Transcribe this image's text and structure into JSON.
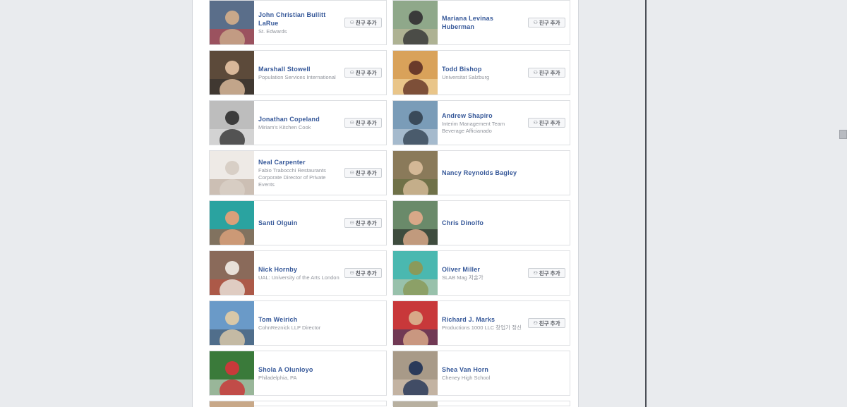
{
  "add_friend_label": "친구 추가",
  "add_friend_icon": "person-plus-icon",
  "people": [
    {
      "name": "John Christian Bullitt LaRue",
      "sub": "St. Edwards",
      "button": true,
      "photo": {
        "bg": "#5a6e8a",
        "fg": "#c9a88a",
        "accent": "#d23c3c"
      }
    },
    {
      "name": "Mariana Levinas Huberman",
      "sub": "",
      "button": true,
      "photo": {
        "bg": "#8fa88a",
        "fg": "#3a3a3a",
        "accent": "#c8b99a"
      }
    },
    {
      "name": "Marshall Stowell",
      "sub": "Population Services International",
      "button": true,
      "photo": {
        "bg": "#5c4a3a",
        "fg": "#d9b89a",
        "accent": "#2a2a2a"
      }
    },
    {
      "name": "Todd Bishop",
      "sub": "Universitat Salzburg",
      "button": true,
      "photo": {
        "bg": "#d9a25a",
        "fg": "#6a3a2a",
        "accent": "#f5e2b0"
      }
    },
    {
      "name": "Jonathan Copeland",
      "sub": "Miriam's Kitchen Cook",
      "button": true,
      "photo": {
        "bg": "#bdbdbd",
        "fg": "#3c3c3c",
        "accent": "#e6e6e6"
      }
    },
    {
      "name": "Andrew Shapiro",
      "sub": "Interim Management Team Beverage Afficianado",
      "button": true,
      "photo": {
        "bg": "#7a9cb8",
        "fg": "#3a4a5a",
        "accent": "#c8d4de"
      }
    },
    {
      "name": "Neal Carpenter",
      "sub": "Fabio Trabocchi Restaurants Corporate Director of Private Events",
      "button": true,
      "photo": {
        "bg": "#eeeae6",
        "fg": "#d8cfc6",
        "accent": "#b09a8a"
      }
    },
    {
      "name": "Nancy Reynolds Bagley",
      "sub": "",
      "button": false,
      "photo": {
        "bg": "#8a7a5a",
        "fg": "#d4b896",
        "accent": "#5a6a3a"
      }
    },
    {
      "name": "Santi Olguin",
      "sub": "",
      "button": true,
      "photo": {
        "bg": "#2aa3a0",
        "fg": "#d9a07a",
        "accent": "#c84a2a"
      }
    },
    {
      "name": "Chris Dinolfo",
      "sub": "",
      "button": false,
      "photo": {
        "bg": "#6a8a6a",
        "fg": "#d8a888",
        "accent": "#1a1a1a"
      }
    },
    {
      "name": "Nick Hornby",
      "sub": "UAL: University of the Arts London",
      "button": true,
      "photo": {
        "bg": "#8a6a5a",
        "fg": "#e8e0d8",
        "accent": "#c84a3a"
      }
    },
    {
      "name": "Oliver Miller",
      "sub": "SLAB Mag 저술가",
      "button": true,
      "photo": {
        "bg": "#4ab8b0",
        "fg": "#8a9a5a",
        "accent": "#d8c8a8"
      }
    },
    {
      "name": "Tom Weirich",
      "sub": "CohnReznick LLP Director",
      "button": false,
      "photo": {
        "bg": "#6a9ac8",
        "fg": "#d8c8a8",
        "accent": "#3a4a5a"
      }
    },
    {
      "name": "Richard J. Marks",
      "sub": "Productions 1000 LLC 창업가 정신",
      "button": true,
      "photo": {
        "bg": "#c8383a",
        "fg": "#d8a888",
        "accent": "#2a3a6a"
      }
    },
    {
      "name": "Shola A Olunloyo",
      "sub": "Philadelphia, PA",
      "button": false,
      "photo": {
        "bg": "#3a7a3a",
        "fg": "#c83a3a",
        "accent": "#e8e8e8"
      }
    },
    {
      "name": "Shea Van Horn",
      "sub": "Cheney High School",
      "button": false,
      "photo": {
        "bg": "#a89a88",
        "fg": "#2a3a5a",
        "accent": "#d8c8b8"
      }
    }
  ]
}
